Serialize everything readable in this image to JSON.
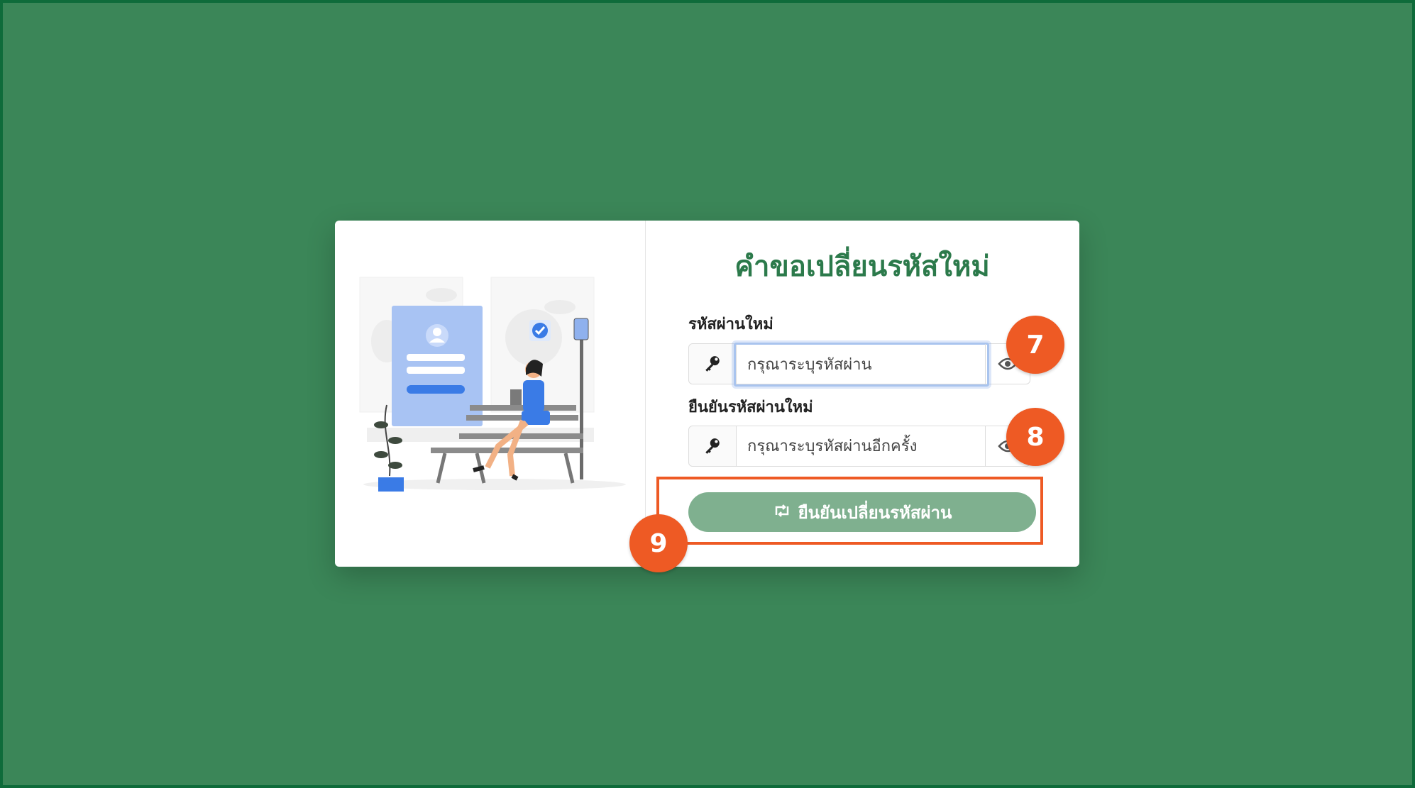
{
  "form": {
    "title": "คำขอเปลี่ยนรหัสใหม่",
    "new_password_label": "รหัสผ่านใหม่",
    "new_password_placeholder": "กรุณาระบุรหัสผ่าน",
    "confirm_password_label": "ยืนยันรหัสผ่านใหม่",
    "confirm_password_placeholder": "กรุณาระบุรหัสผ่านอีกครั้ง",
    "submit_label": "ยืนยันเปลี่ยนรหัสผ่าน",
    "key_icon": "key-icon",
    "eye_icon": "eye-icon",
    "submit_icon": "retweet-icon"
  },
  "markers": {
    "step7": "7",
    "step8": "8",
    "step9": "9"
  },
  "colors": {
    "background": "#3b8658",
    "title": "#2c7a4b",
    "button": "#7fb08f",
    "marker": "#ee5a24"
  }
}
